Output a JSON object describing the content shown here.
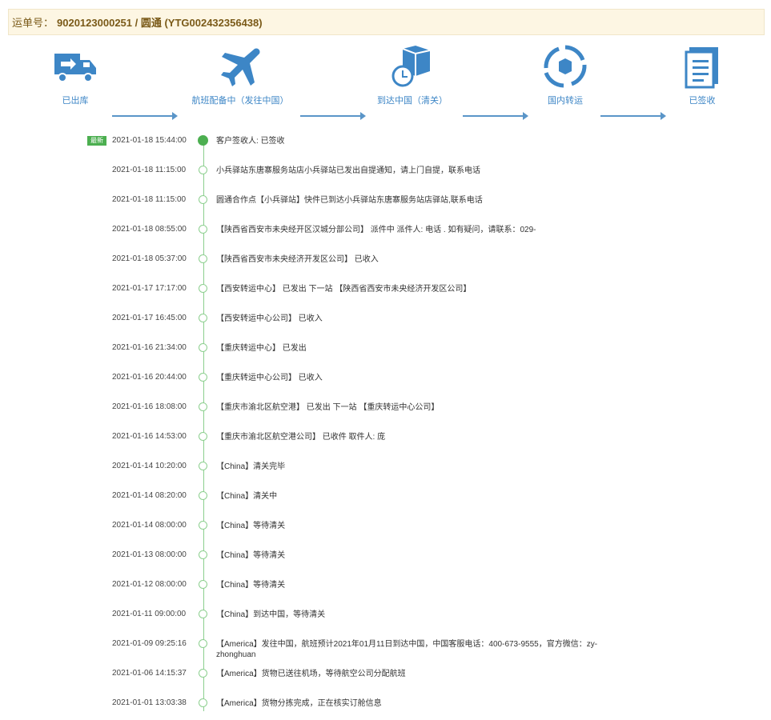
{
  "header": {
    "label": "运单号：",
    "tracking": "9020123000251 / 圆通 (YTG002432356438)"
  },
  "steps": [
    {
      "label": "已出库",
      "icon": "truck-icon"
    },
    {
      "label": "航班配备中（发往中国）",
      "icon": "airplane-icon"
    },
    {
      "label": "到达中国（清关）",
      "icon": "package-clock-icon"
    },
    {
      "label": "国内转运",
      "icon": "transfer-icon"
    },
    {
      "label": "已签收",
      "icon": "clipboard-icon"
    }
  ],
  "latest_badge": "最新",
  "events": [
    {
      "time": "2021-01-18 15:44:00",
      "text": "客户签收人: 已签收"
    },
    {
      "time": "2021-01-18 11:15:00",
      "text": "小兵驿站东唐寨服务站店小兵驿站已发出自提通知，请上门自提，联系电话"
    },
    {
      "time": "2021-01-18 11:15:00",
      "text": "圆通合作点【小兵驿站】快件已到达小兵驿站东唐寨服务站店驿站,联系电话"
    },
    {
      "time": "2021-01-18 08:55:00",
      "text": "【陕西省西安市未央经开区汉城分部公司】 派件中 派件人: 电话 . 如有疑问，请联系：029-"
    },
    {
      "time": "2021-01-18 05:37:00",
      "text": "【陕西省西安市未央经济开发区公司】 已收入"
    },
    {
      "time": "2021-01-17 17:17:00",
      "text": "【西安转运中心】 已发出 下一站 【陕西省西安市未央经济开发区公司】"
    },
    {
      "time": "2021-01-17 16:45:00",
      "text": "【西安转运中心公司】 已收入"
    },
    {
      "time": "2021-01-16 21:34:00",
      "text": "【重庆转运中心】 已发出"
    },
    {
      "time": "2021-01-16 20:44:00",
      "text": "【重庆转运中心公司】 已收入"
    },
    {
      "time": "2021-01-16 18:08:00",
      "text": "【重庆市渝北区航空港】 已发出 下一站 【重庆转运中心公司】"
    },
    {
      "time": "2021-01-16 14:53:00",
      "text": "【重庆市渝北区航空港公司】 已收件 取件人: 庞"
    },
    {
      "time": "2021-01-14 10:20:00",
      "text": "【China】清关完毕"
    },
    {
      "time": "2021-01-14 08:20:00",
      "text": "【China】清关中"
    },
    {
      "time": "2021-01-14 08:00:00",
      "text": "【China】等待清关"
    },
    {
      "time": "2021-01-13 08:00:00",
      "text": "【China】等待清关"
    },
    {
      "time": "2021-01-12 08:00:00",
      "text": "【China】等待清关"
    },
    {
      "time": "2021-01-11 09:00:00",
      "text": "【China】到达中国，等待清关"
    },
    {
      "time": "2021-01-09 09:25:16",
      "text": "【America】发往中国，航班预计2021年01月11日到达中国，中国客服电话：400-673-9555，官方微信：zy-zhonghuan"
    },
    {
      "time": "2021-01-06 14:15:37",
      "text": "【America】货物已送往机场，等待航空公司分配航班"
    },
    {
      "time": "2021-01-01 13:03:38",
      "text": "【America】货物分拣完成，正在核实订舱信息"
    }
  ]
}
